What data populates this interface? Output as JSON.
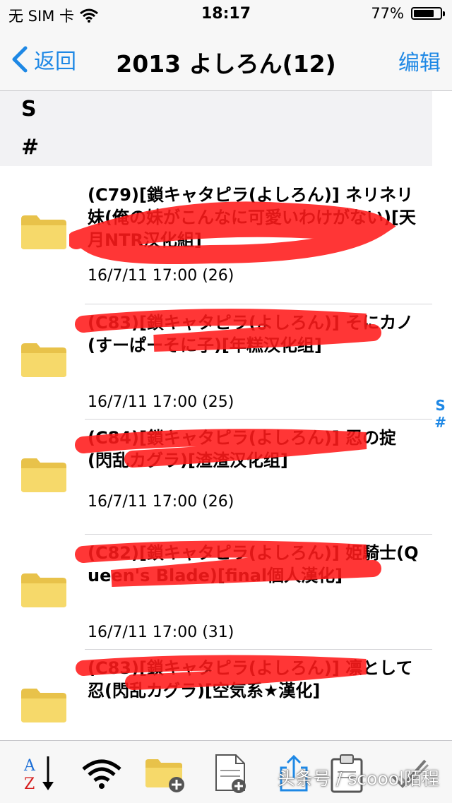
{
  "status": {
    "carrier": "无 SIM 卡",
    "time": "18:17",
    "battery": "77%",
    "battery_level": 0.77
  },
  "nav": {
    "back_label": "返回",
    "title": "2013 よしろん(12)",
    "edit_label": "编辑"
  },
  "section_index": [
    "S",
    "#"
  ],
  "items": [
    {
      "title": "(C79)[鎖キャタピラ(よしろん)] ネリネリ妹(俺の妹がこんなに可愛いわけがない)[天月NTR汉化組]",
      "meta": "16/7/11 17:00 (26)"
    },
    {
      "title": "(C83)[鎖キャタピラ(よしろん)] そにカノ(すーぱーそに子)[年糕汉化组]",
      "meta": "16/7/11 17:00 (25)"
    },
    {
      "title": "(C84)[鎖キャタピラ(よしろん)] 忍の掟(閃乱カグラ)[渣渣汉化组]",
      "meta": "16/7/11 17:00 (26)"
    },
    {
      "title": "(C82)[鎖キャタピラ(よしろん)] 姫騎士(Queen's Blade)[final個人漢化]",
      "meta": "16/7/11 17:00 (31)"
    },
    {
      "title": "(C83)[鎖キャタピラ(よしろん)] 凛として忍(閃乱カグラ)[空気系★漢化]",
      "meta": ""
    }
  ],
  "side_index": [
    "S",
    "#"
  ],
  "toolbar": {
    "sort_icon": "sort-az-icon",
    "wifi_icon": "wifi-icon",
    "new_folder_icon": "new-folder-icon",
    "new_file_icon": "new-file-icon",
    "share_icon": "share-icon",
    "paste_icon": "clipboard-icon",
    "select_icon": "checkmark-icon"
  },
  "watermark": "头条号 / scoool陌程",
  "colors": {
    "accent": "#1e88e5",
    "scribble": "#ff1a1a",
    "folder": "#f6d96a"
  }
}
